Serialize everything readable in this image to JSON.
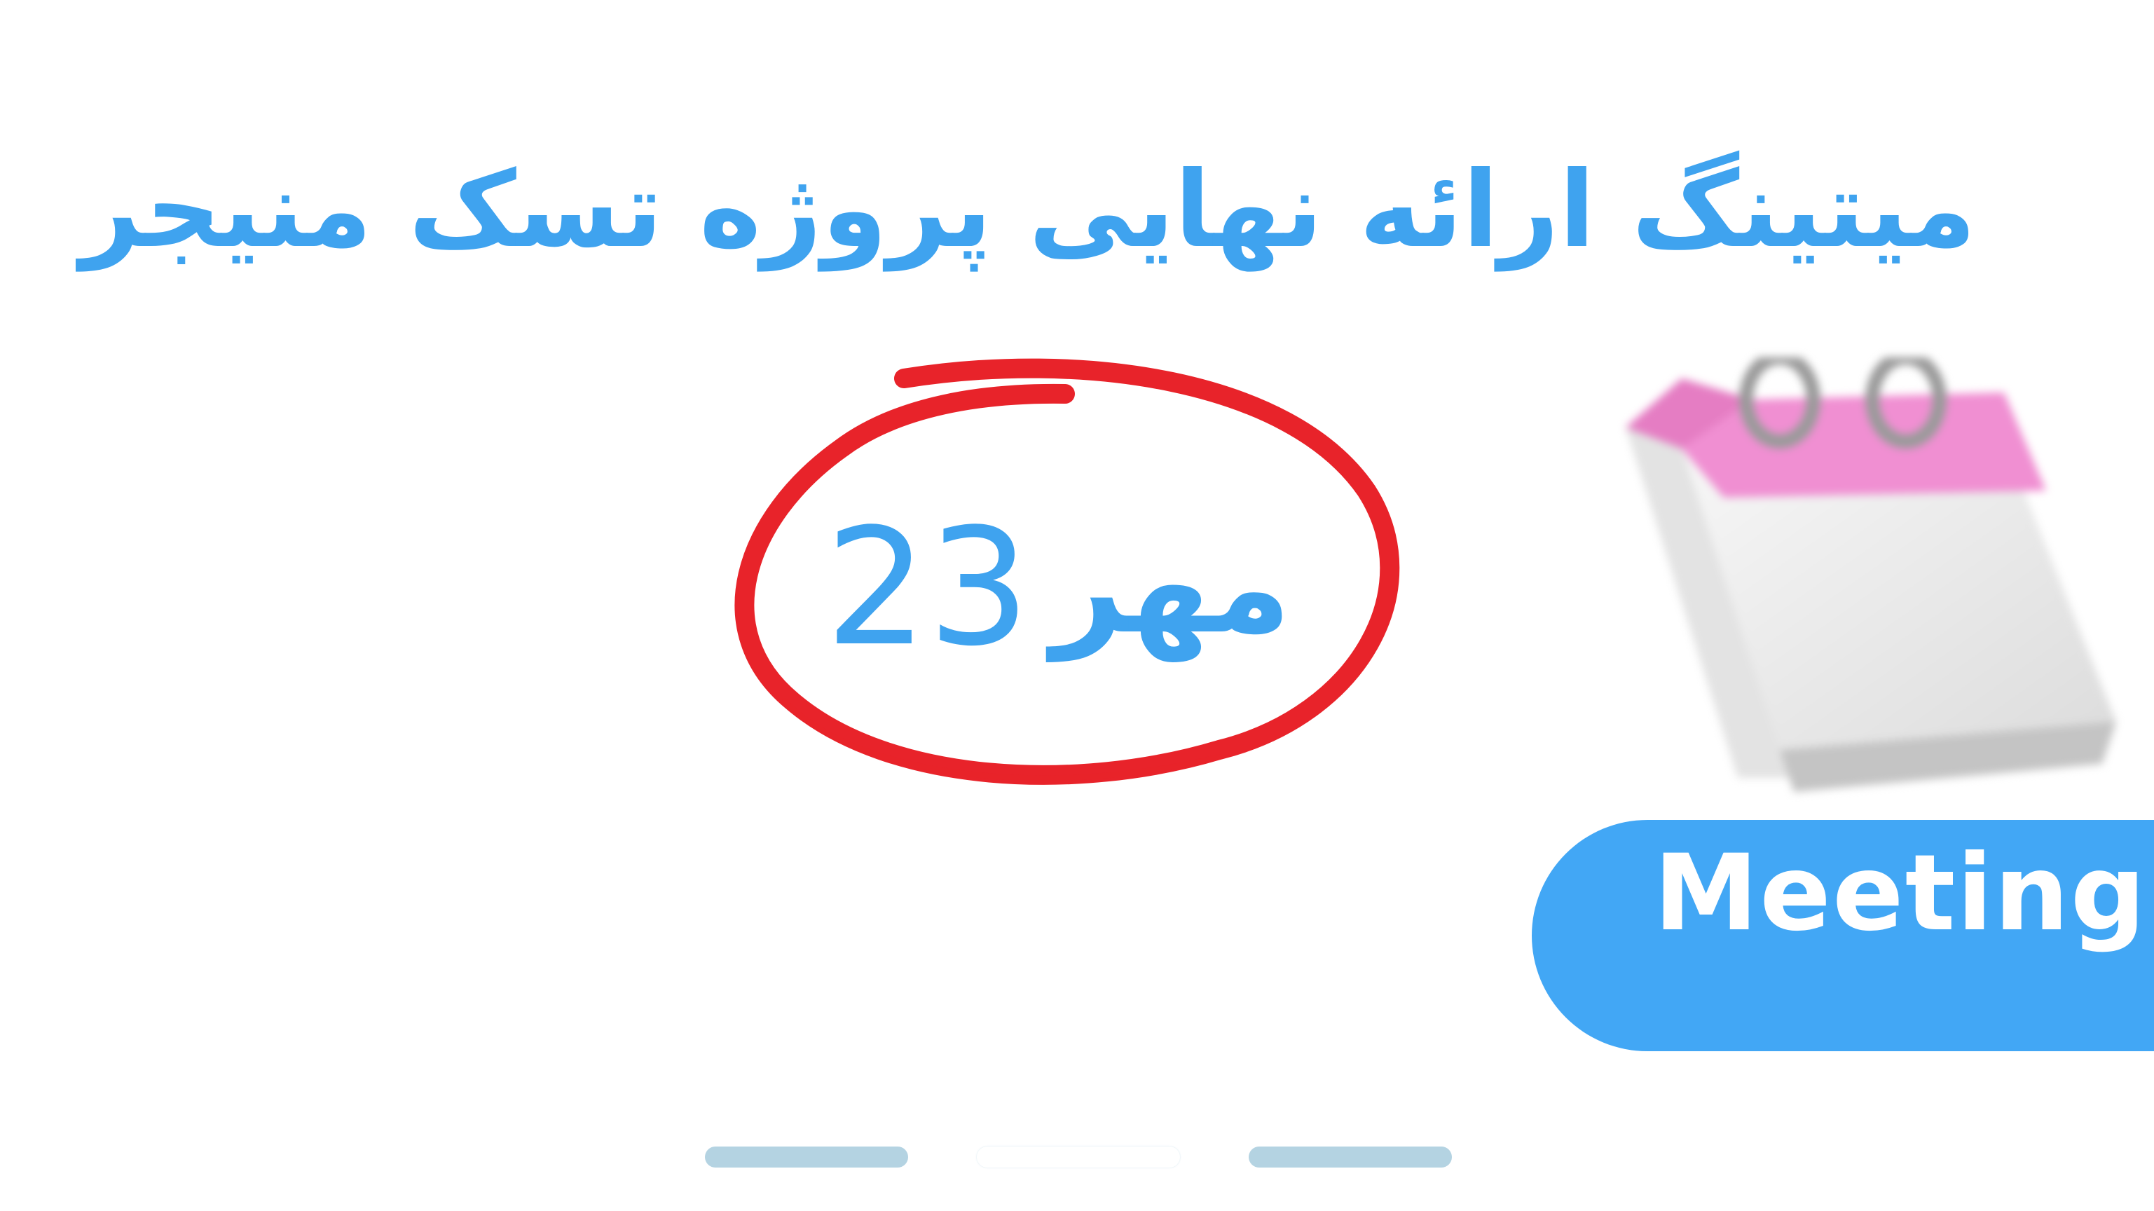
{
  "slide": {
    "title": "میتینگ ارائه نهایی پروژه تسک منیجر",
    "date": {
      "day": "23",
      "month": "مهر"
    },
    "badge_label": "Meeting",
    "calendar_icon": "tear-off-calendar-icon",
    "pager": {
      "count": 3,
      "active_index": 1
    }
  },
  "colors": {
    "text_primary": "#3fa3ef",
    "circle_stroke": "#e8232a",
    "badge_background": "#42a7f5",
    "badge_text": "#ffffff",
    "pager_inactive": "#b4d3e2",
    "pager_active": "#ffffff",
    "calendar_top": "#f08fd2",
    "calendar_page": "#f0f0f0"
  }
}
